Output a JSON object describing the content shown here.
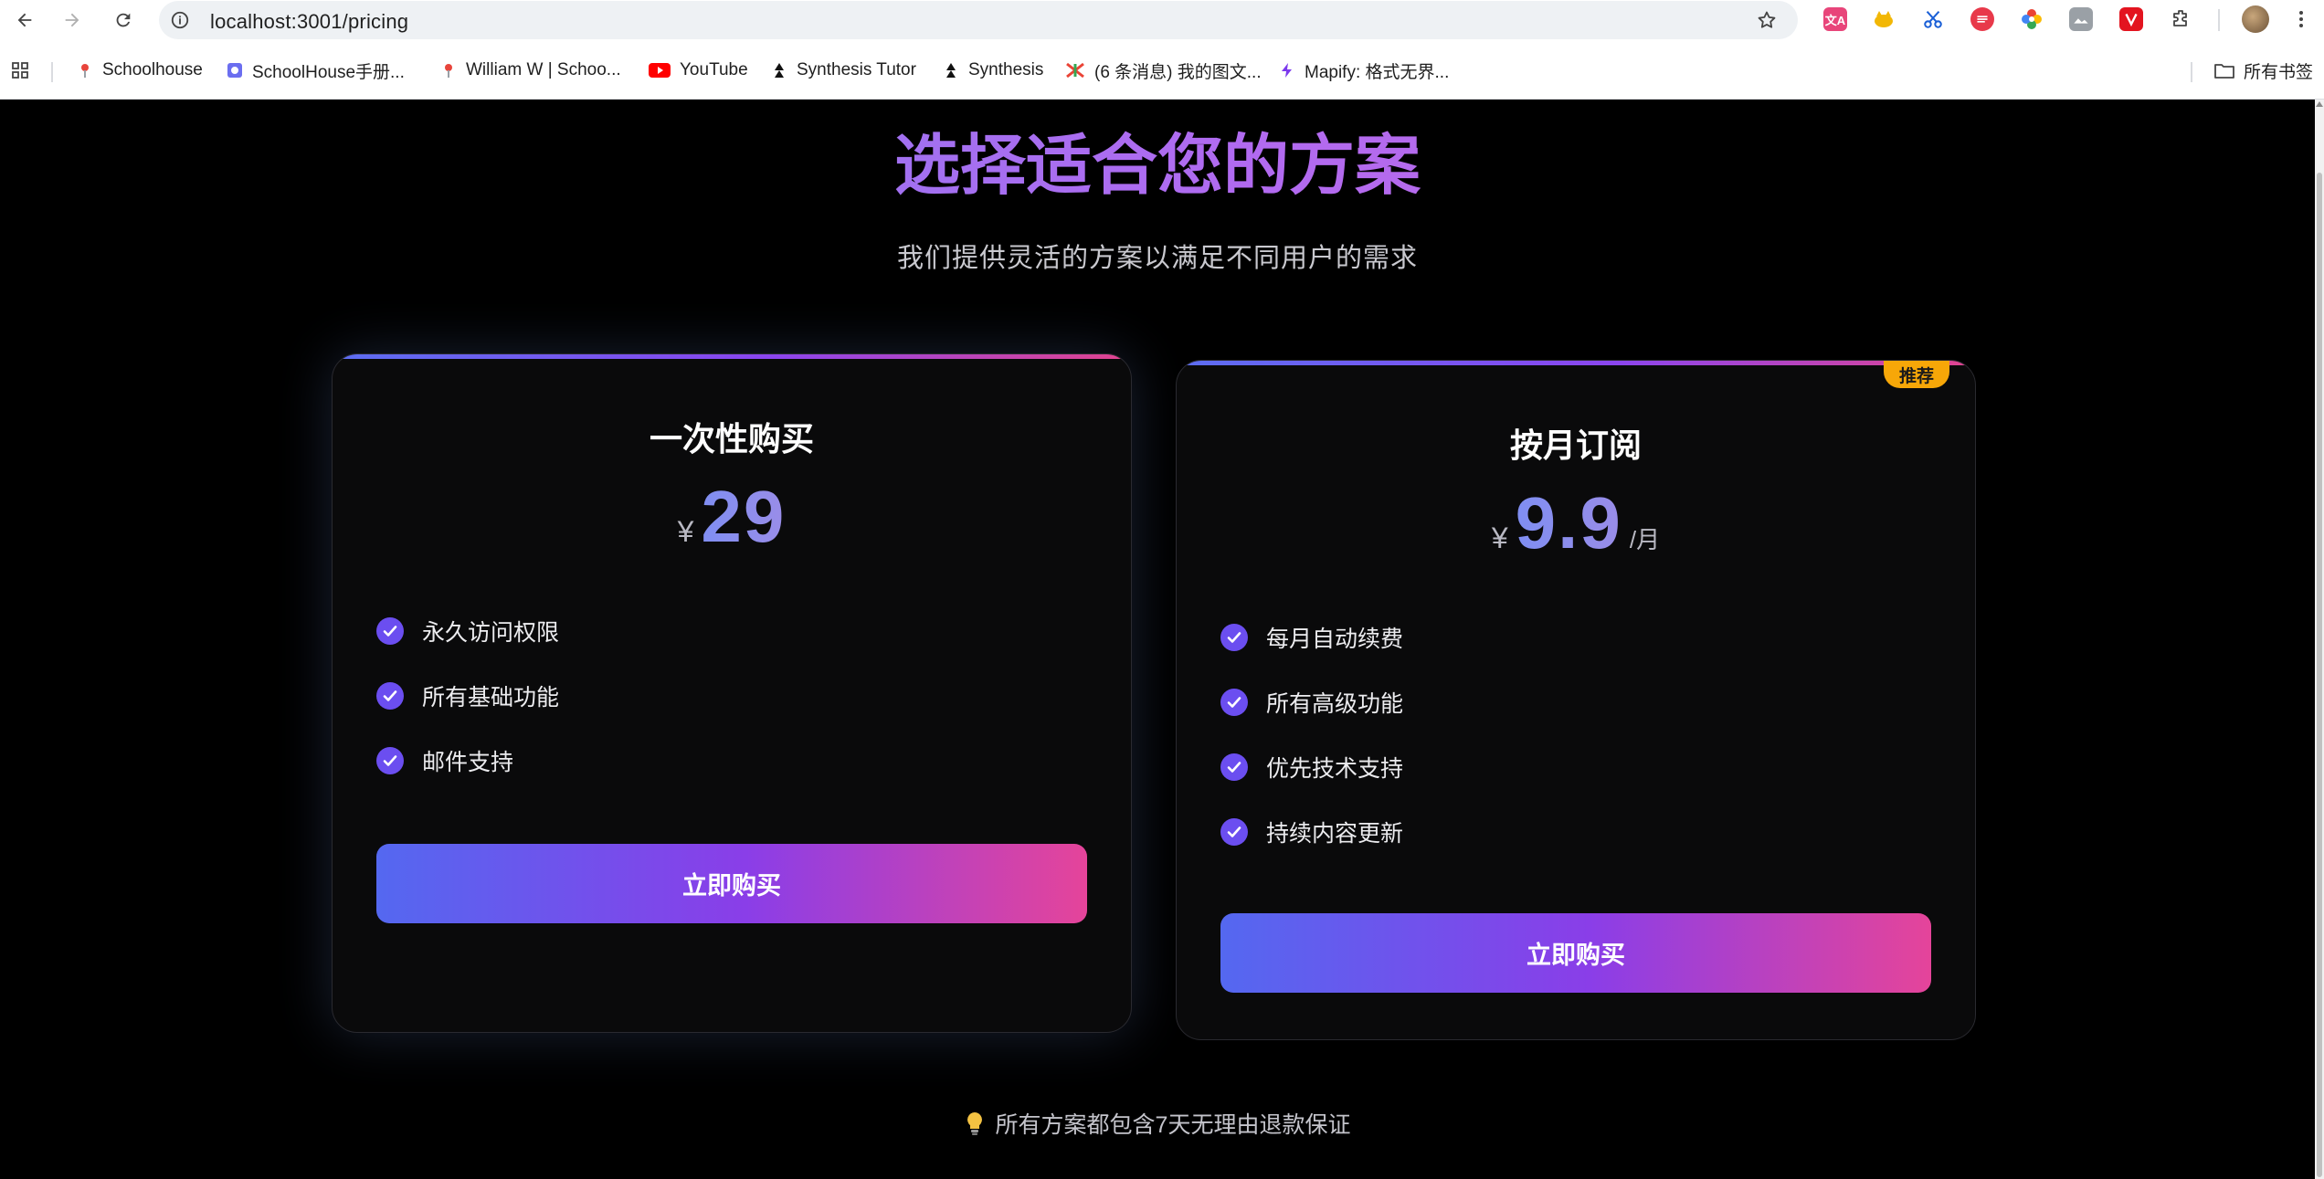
{
  "browser": {
    "url": "localhost:3001/pricing",
    "bookmarks": [
      {
        "label": "Schoolhouse",
        "icon": "schoolhouse-icon",
        "color": "#e8453c"
      },
      {
        "label": "SchoolHouse手册...",
        "icon": "schoolhouse-manual-icon",
        "color": "#6b6ef0"
      },
      {
        "label": "William W | Schoo...",
        "icon": "schoolhouse-profile-icon",
        "color": "#e8453c"
      },
      {
        "label": "YouTube",
        "icon": "youtube-icon",
        "color": "#ff0000"
      },
      {
        "label": "Synthesis Tutor",
        "icon": "synthesis-icon",
        "color": "#000000"
      },
      {
        "label": "Synthesis",
        "icon": "synthesis-icon",
        "color": "#000000"
      },
      {
        "label": "(6 条消息) 我的图文...",
        "icon": "csdn-icon",
        "color": "#ea4335"
      },
      {
        "label": "Mapify: 格式无界...",
        "icon": "mapify-icon",
        "color": "#7c3aed"
      }
    ],
    "all_bookmarks_label": "所有书签",
    "extension_badge": "文A"
  },
  "page": {
    "title": "选择适合您的方案",
    "subtitle": "我们提供灵活的方案以满足不同用户的需求",
    "plans": [
      {
        "name": "一次性购买",
        "currency": "¥",
        "price": "29",
        "period": "",
        "badge": "",
        "features": [
          "永久访问权限",
          "所有基础功能",
          "邮件支持"
        ],
        "button": "立即购买"
      },
      {
        "name": "按月订阅",
        "currency": "¥",
        "price": "9.9",
        "period": "/月",
        "badge": "推荐",
        "features": [
          "每月自动续费",
          "所有高级功能",
          "优先技术支持",
          "持续内容更新"
        ],
        "button": "立即购买"
      }
    ],
    "footnote": "所有方案都包含7天无理由退款保证"
  },
  "colors": {
    "accent_gradient_start": "#5468f0",
    "accent_gradient_mid": "#8a3ee8",
    "accent_gradient_end": "#e5449a",
    "badge": "#f7a708",
    "check": "#6b4ef0"
  }
}
